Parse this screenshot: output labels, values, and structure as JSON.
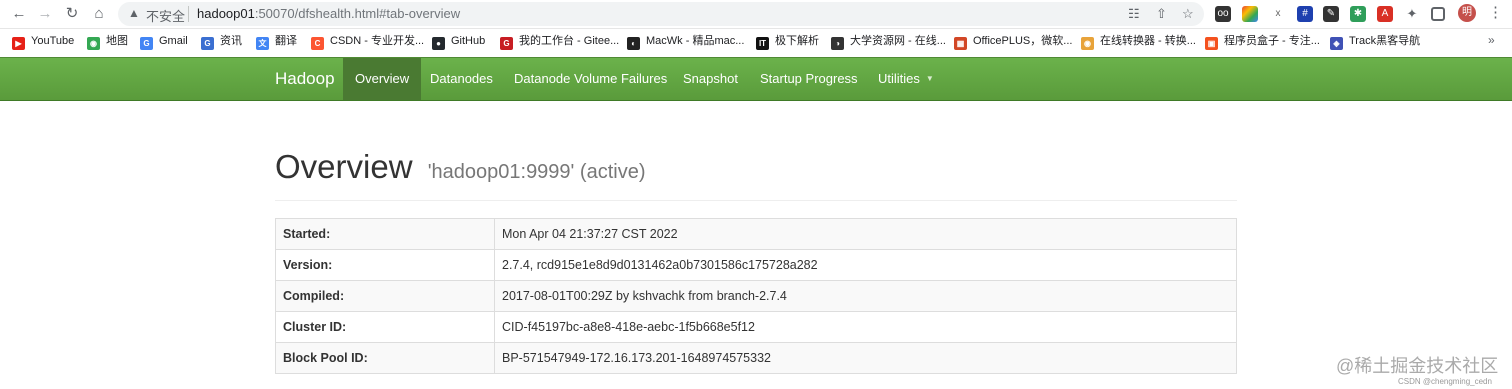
{
  "browser": {
    "insecure_label": "不安全",
    "url_host": "hadoop01",
    "url_rest": ":50070/dfshealth.html#tab-overview",
    "profile_initial": "明"
  },
  "bookmarks": [
    {
      "label": "YouTube",
      "icon": "youtube-icon",
      "color": "#e62117"
    },
    {
      "label": "地图",
      "icon": "maps-icon",
      "color": "#34a853"
    },
    {
      "label": "Gmail",
      "icon": "google-icon",
      "color": "#4285f4"
    },
    {
      "label": "资讯",
      "icon": "news-icon",
      "color": "#3b6fd1"
    },
    {
      "label": "翻译",
      "icon": "translate-icon",
      "color": "#4285f4"
    },
    {
      "label": "CSDN - 专业开发...",
      "icon": "csdn-icon",
      "color": "#fc5531"
    },
    {
      "label": "GitHub",
      "icon": "github-icon",
      "color": "#24292e"
    },
    {
      "label": "我的工作台 - Gitee...",
      "icon": "gitee-icon",
      "color": "#c71d23"
    },
    {
      "label": "MacWk - 精品mac...",
      "icon": "macwk-icon",
      "color": "#222222"
    },
    {
      "label": "极下解析",
      "icon": "jixia-icon",
      "color": "#111111"
    },
    {
      "label": "大学资源网 - 在线...",
      "icon": "university-icon",
      "color": "#333333"
    },
    {
      "label": "OfficePLUS，微软...",
      "icon": "officeplus-icon",
      "color": "#d24726"
    },
    {
      "label": "在线转换器 - 转换...",
      "icon": "converter-icon",
      "color": "#e8a33a"
    },
    {
      "label": "程序员盒子 - 专注...",
      "icon": "box-icon",
      "color": "#f4511e"
    },
    {
      "label": "Track黑客导航",
      "icon": "track-icon",
      "color": "#3f51b5"
    }
  ],
  "navbar": {
    "brand": "Hadoop",
    "items": [
      "Overview",
      "Datanodes",
      "Datanode Volume Failures",
      "Snapshot",
      "Startup Progress",
      "Utilities"
    ],
    "active": "Overview"
  },
  "overview": {
    "title": "Overview",
    "subtitle": "'hadoop01:9999' (active)",
    "rows": [
      {
        "key": "Started:",
        "value": "Mon Apr 04 21:37:27 CST 2022"
      },
      {
        "key": "Version:",
        "value": "2.7.4, rcd915e1e8d9d0131462a0b7301586c175728a282"
      },
      {
        "key": "Compiled:",
        "value": "2017-08-01T00:29Z by kshvachk from branch-2.7.4"
      },
      {
        "key": "Cluster ID:",
        "value": "CID-f45197bc-a8e8-418e-aebc-1f5b668e5f12"
      },
      {
        "key": "Block Pool ID:",
        "value": "BP-571547949-172.16.173.201-1648974575332"
      }
    ]
  },
  "watermark": {
    "main": "@稀土掘金技术社区",
    "small": "CSDN @chengming_cedn"
  }
}
